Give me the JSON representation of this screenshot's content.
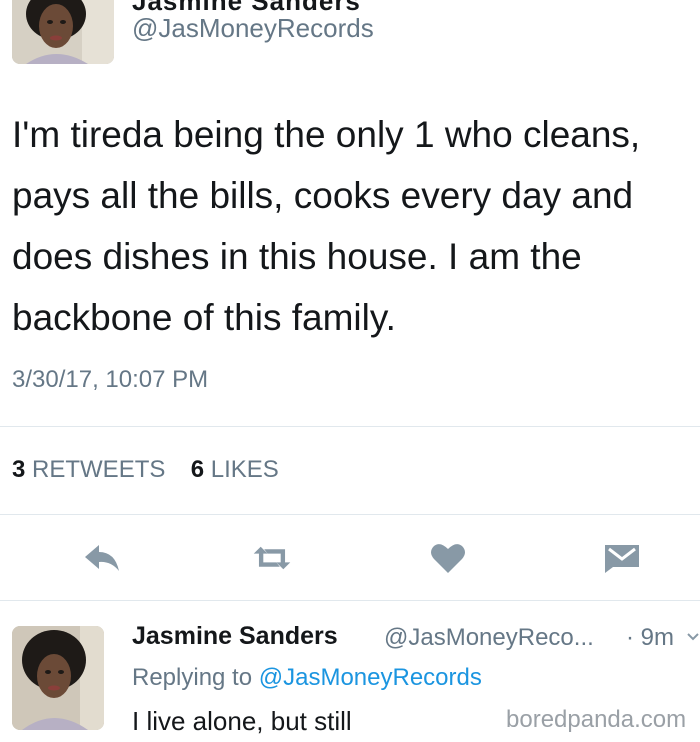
{
  "tweet": {
    "display_name_partial": "Jasmine Sanders",
    "handle": "@JasMoneyRecords",
    "text": "I'm tireda being the only 1 who cleans,\npays all the bills, cooks every day and\ndoes dishes in this house. I am the\nbackbone of this family.",
    "timestamp": "3/30/17, 10:07 PM",
    "retweet_count": "3",
    "retweet_label": "RETWEETS",
    "like_count": "6",
    "like_label": "LIKES"
  },
  "actions": {
    "reply_icon": "reply-icon",
    "retweet_icon": "retweet-icon",
    "like_icon": "heart-icon",
    "message_icon": "envelope-icon"
  },
  "reply": {
    "display_name": "Jasmine Sanders",
    "handle": "@JasMoneyReco...",
    "time": "· 9m",
    "replying_prefix": "Replying to",
    "replying_to": "@JasMoneyRecords",
    "text": "I live alone, but still"
  },
  "watermark": "boredpanda.com",
  "colors": {
    "text": "#14171a",
    "secondary": "#657786",
    "link": "#1b95e0",
    "icon": "#8899a6",
    "divider": "#e1e8ed"
  }
}
